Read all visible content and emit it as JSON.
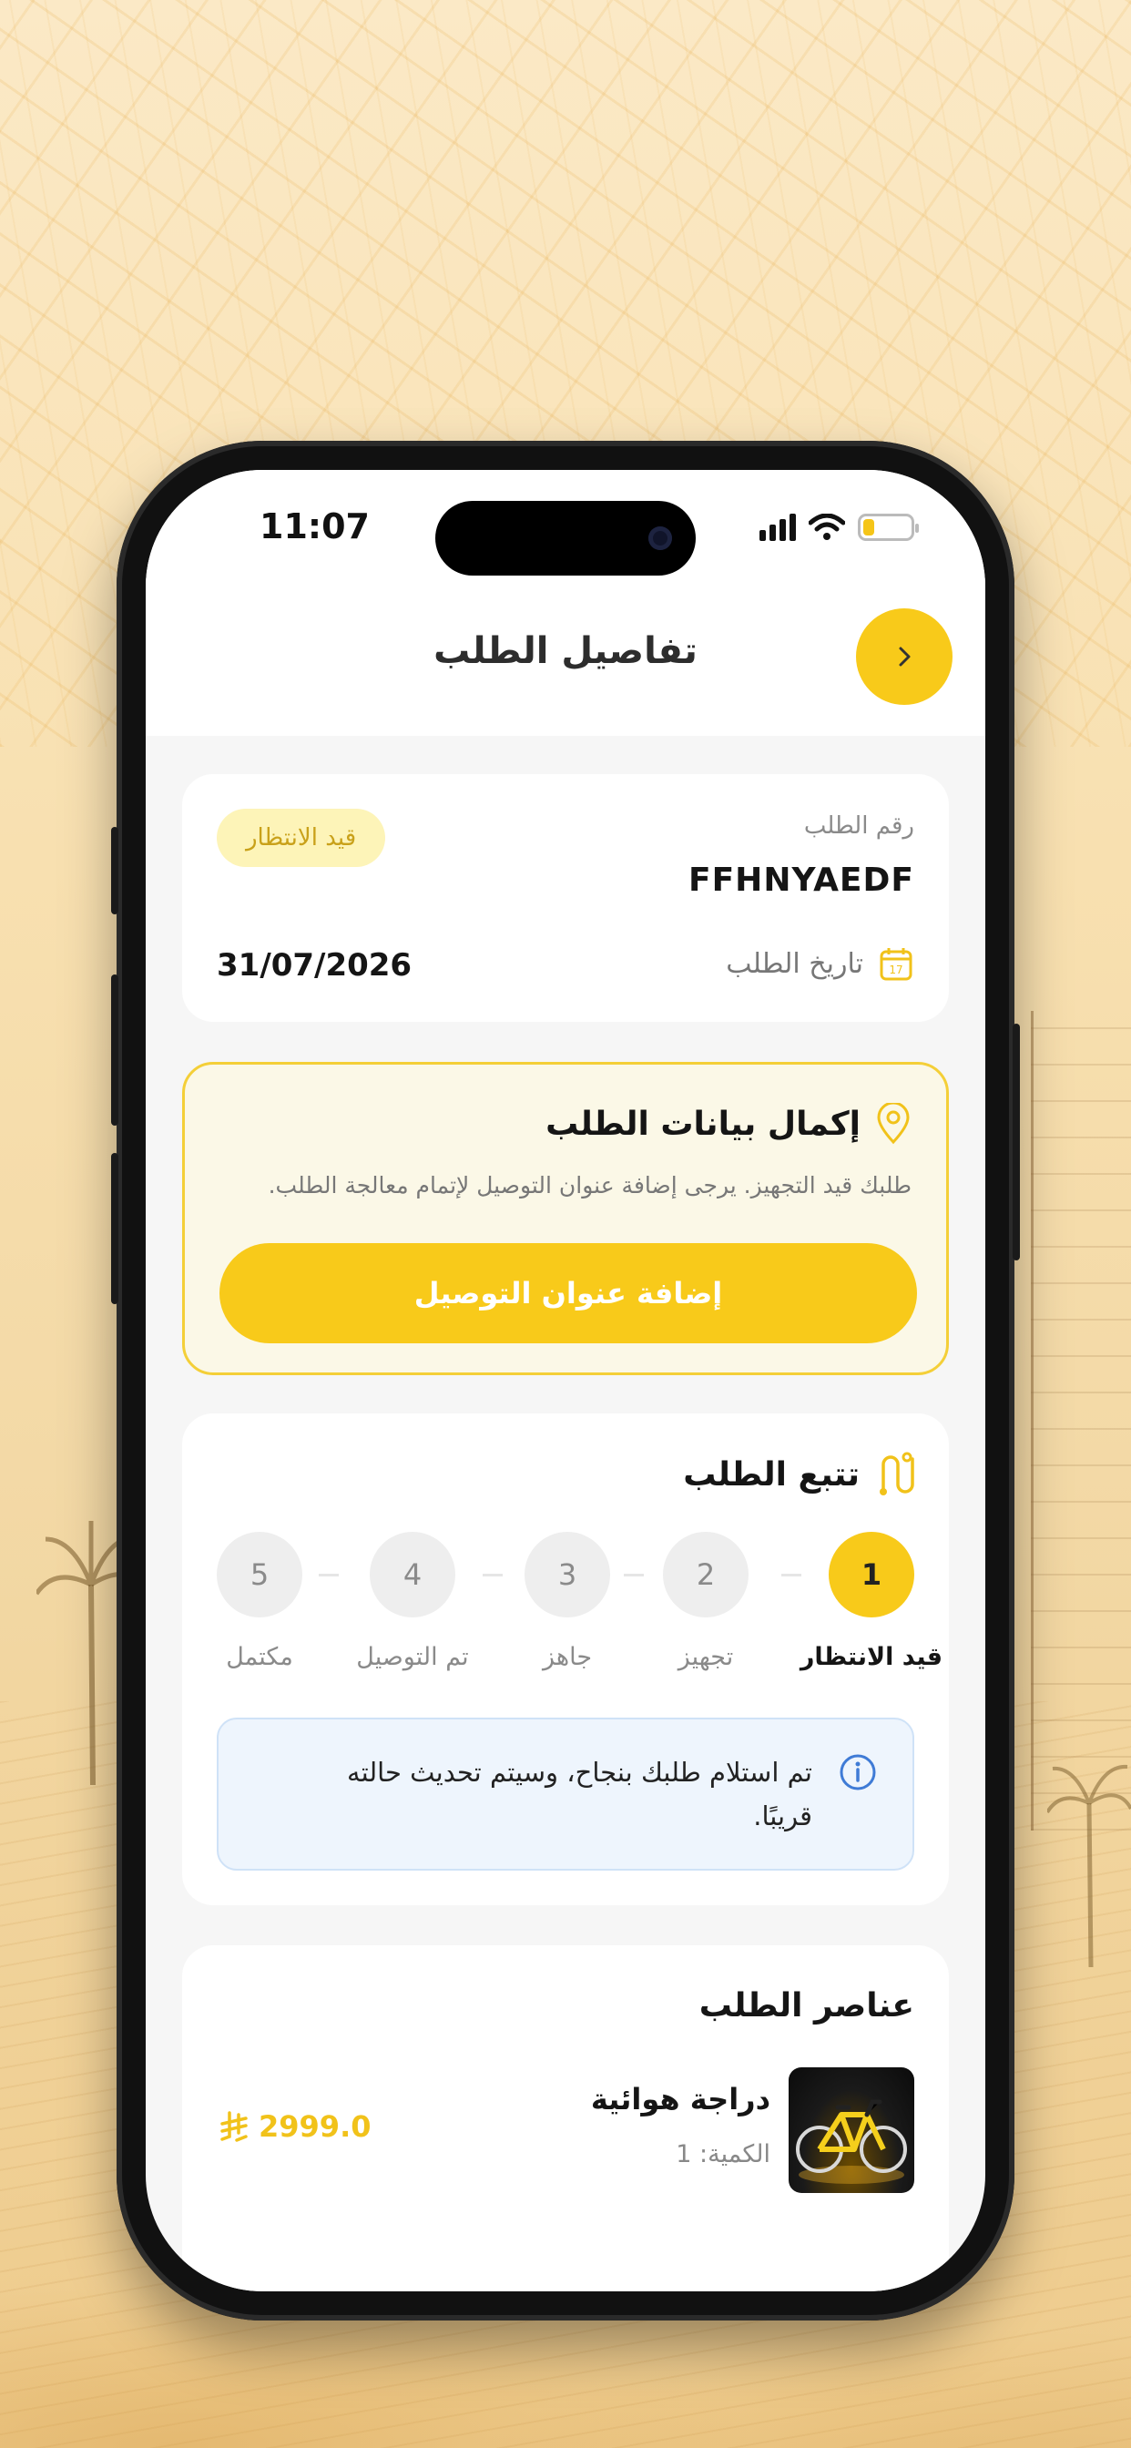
{
  "status_bar": {
    "time": "11:07"
  },
  "header": {
    "title": "تفاصيل الطلب",
    "back_icon": "chevron-right-icon"
  },
  "order": {
    "status_badge": "قيد الانتظار",
    "number_label": "رقم الطلب",
    "number": "FFHNYAEDF",
    "date_label": "تاريخ الطلب",
    "date": "31/07/2026",
    "calendar_day": "17"
  },
  "complete_data": {
    "title": "إكمال بيانات الطلب",
    "description": "طلبك قيد التجهيز. يرجى إضافة عنوان التوصيل لإتمام معالجة الطلب.",
    "button_label": "إضافة عنوان التوصيل",
    "accent_color": "#f8ca1a"
  },
  "tracking": {
    "title": "تتبع الطلب",
    "current_step": 1,
    "steps": [
      {
        "number": "1",
        "label": "قيد الانتظار"
      },
      {
        "number": "2",
        "label": "تجهيز"
      },
      {
        "number": "3",
        "label": "جاهز"
      },
      {
        "number": "4",
        "label": "تم التوصيل"
      },
      {
        "number": "5",
        "label": "مكتمل"
      }
    ],
    "info_text": "تم استلام طلبك بنجاح، وسيتم تحديث حالته قريبًا."
  },
  "items": {
    "title": "عناصر الطلب",
    "list": [
      {
        "name": "دراجة هوائية",
        "quantity": "الكمية: 1",
        "price": "2999.0",
        "currency_icon": "riyal-icon"
      }
    ]
  }
}
